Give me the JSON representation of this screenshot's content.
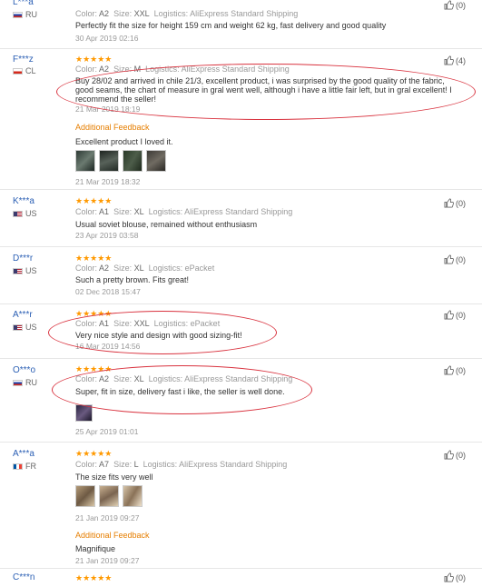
{
  "reviews": [
    {
      "user": "L***a",
      "country": "RU",
      "stars": "★★★★★",
      "color_label": "Color:",
      "color": "A2",
      "size_label": "Size:",
      "size": "XXL",
      "logistics_label": "Logistics:",
      "logistics": "AliExpress Standard Shipping",
      "text": "Perfectly fit the size for height 159 cm and weight 62 kg, fast delivery and good quality",
      "date": "30 Apr 2019 02:16",
      "helpful": "(0)"
    },
    {
      "user": "F***z",
      "country": "CL",
      "stars": "★★★★★",
      "color_label": "Color:",
      "color": "A2",
      "size_label": "Size:",
      "size": "M",
      "logistics_label": "Logistics:",
      "logistics": "AliExpress Standard Shipping",
      "text": "Buy 28/02 and arrived in chile 21/3, excellent product, i was surprised by the good quality of the fabric, good seams, the chart of measure in gral went well, although i have a little fair left, but in gral excellent! I recommend the seller!",
      "date": "21 Mar 2019 18:19",
      "helpful": "(4)",
      "feedback_title": "Additional Feedback",
      "feedback_text": "Excellent product I loved it.",
      "feedback_date": "21 Mar 2019 18:32"
    },
    {
      "user": "K***a",
      "country": "US",
      "stars": "★★★★★",
      "color_label": "Color:",
      "color": "A1",
      "size_label": "Size:",
      "size": "XL",
      "logistics_label": "Logistics:",
      "logistics": "AliExpress Standard Shipping",
      "text": "Usual soviet blouse, remained without enthusiasm",
      "date": "23 Apr 2019 03:58",
      "helpful": "(0)"
    },
    {
      "user": "D***r",
      "country": "US",
      "stars": "★★★★★",
      "color_label": "Color:",
      "color": "A2",
      "size_label": "Size:",
      "size": "XL",
      "logistics_label": "Logistics:",
      "logistics": "ePacket",
      "text": "Such a pretty brown. Fits great!",
      "date": "02 Dec 2018 15:47",
      "helpful": "(0)"
    },
    {
      "user": "A***r",
      "country": "US",
      "stars": "★★★★★",
      "color_label": "Color:",
      "color": "A1",
      "size_label": "Size:",
      "size": "XXL",
      "logistics_label": "Logistics:",
      "logistics": "ePacket",
      "text": "Very nice style and design with good sizing-fit!",
      "date": "16 Mar 2019 14:56",
      "helpful": "(0)"
    },
    {
      "user": "O***o",
      "country": "RU",
      "stars": "★★★★★",
      "color_label": "Color:",
      "color": "A2",
      "size_label": "Size:",
      "size": "XL",
      "logistics_label": "Logistics:",
      "logistics": "AliExpress Standard Shipping",
      "text": "Super, fit in size, delivery fast i like, the seller is well done.",
      "date": "25 Apr 2019 01:01",
      "helpful": "(0)"
    },
    {
      "user": "A***a",
      "country": "FR",
      "stars": "★★★★★",
      "color_label": "Color:",
      "color": "A7",
      "size_label": "Size:",
      "size": "L",
      "logistics_label": "Logistics:",
      "logistics": "AliExpress Standard Shipping",
      "text": "The size fits very well",
      "date": "21 Jan 2019 09:27",
      "helpful": "(0)",
      "feedback_title": "Additional Feedback",
      "feedback_text": "Magnifique",
      "feedback_date": "21 Jan 2019 09:27"
    },
    {
      "user": "C***n",
      "stars": "★★★★★",
      "helpful": "(0)"
    }
  ],
  "colors": {
    "star": "#ff9900",
    "username": "#2b5fb4",
    "feedback_title": "#e67e00",
    "annotation": "#d9333f"
  }
}
